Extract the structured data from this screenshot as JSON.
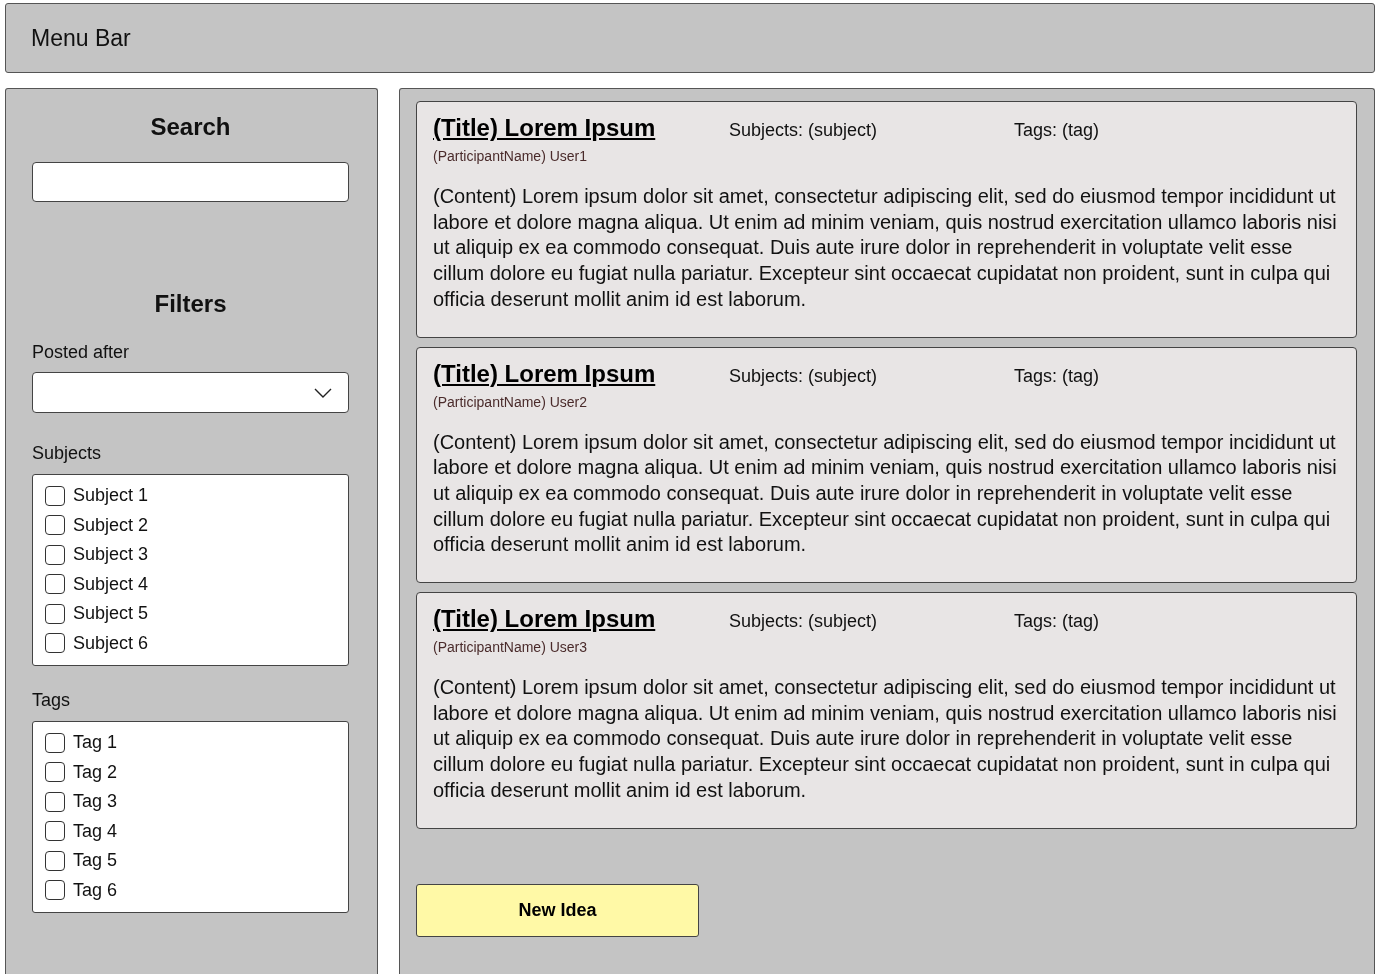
{
  "menu_bar": {
    "title": "Menu Bar"
  },
  "sidebar": {
    "search": {
      "heading": "Search"
    },
    "filters": {
      "heading": "Filters",
      "posted_after": {
        "label": "Posted after"
      },
      "subjects": {
        "label": "Subjects",
        "items": [
          {
            "label": "Subject 1",
            "checked": false
          },
          {
            "label": "Subject 2",
            "checked": false
          },
          {
            "label": "Subject 3",
            "checked": false
          },
          {
            "label": "Subject 4",
            "checked": false
          },
          {
            "label": "Subject 5",
            "checked": false
          },
          {
            "label": "Subject 6",
            "checked": false
          }
        ]
      },
      "tags": {
        "label": "Tags",
        "items": [
          {
            "label": "Tag 1",
            "checked": false
          },
          {
            "label": "Tag 2",
            "checked": false
          },
          {
            "label": "Tag 3",
            "checked": false
          },
          {
            "label": "Tag 4",
            "checked": false
          },
          {
            "label": "Tag 5",
            "checked": false
          },
          {
            "label": "Tag 6",
            "checked": false
          }
        ]
      }
    }
  },
  "ideas": [
    {
      "title": "(Title) Lorem Ipsum",
      "subjects": "Subjects: (subject)",
      "tags": "Tags: (tag)",
      "participant": "(ParticipantName) User1",
      "content": "(Content) Lorem ipsum dolor sit amet, consectetur adipiscing elit, sed do eiusmod tempor incididunt ut labore et dolore magna aliqua. Ut enim ad minim veniam, quis nostrud exercitation ullamco laboris nisi ut aliquip ex ea commodo consequat. Duis aute irure dolor in reprehenderit in voluptate velit esse cillum dolore eu fugiat nulla pariatur. Excepteur sint occaecat cupidatat non proident, sunt in culpa qui officia deserunt mollit anim id est laborum."
    },
    {
      "title": "(Title) Lorem Ipsum",
      "subjects": "Subjects: (subject)",
      "tags": "Tags: (tag)",
      "participant": "(ParticipantName) User2",
      "content": "(Content) Lorem ipsum dolor sit amet, consectetur adipiscing elit, sed do eiusmod tempor incididunt ut labore et dolore magna aliqua. Ut enim ad minim veniam, quis nostrud exercitation ullamco laboris nisi ut aliquip ex ea commodo consequat. Duis aute irure dolor in reprehenderit in voluptate velit esse cillum dolore eu fugiat nulla pariatur. Excepteur sint occaecat cupidatat non proident, sunt in culpa qui officia deserunt mollit anim id est laborum."
    },
    {
      "title": "(Title) Lorem Ipsum",
      "subjects": "Subjects: (subject)",
      "tags": "Tags: (tag)",
      "participant": "(ParticipantName) User3",
      "content": "(Content) Lorem ipsum dolor sit amet, consectetur adipiscing elit, sed do eiusmod tempor incididunt ut labore et dolore magna aliqua. Ut enim ad minim veniam, quis nostrud exercitation ullamco laboris nisi ut aliquip ex ea commodo consequat. Duis aute irure dolor in reprehenderit in voluptate velit esse cillum dolore eu fugiat nulla pariatur. Excepteur sint occaecat cupidatat non proident, sunt in culpa qui officia deserunt mollit anim id est laborum."
    }
  ],
  "new_idea_button": {
    "label": "New Idea"
  }
}
